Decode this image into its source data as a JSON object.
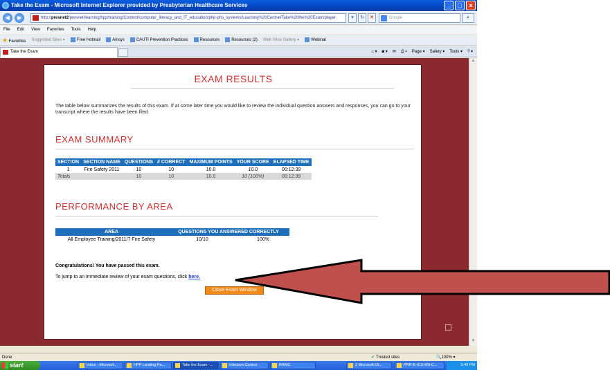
{
  "window": {
    "title": "Take the Exam - Microsoft Internet Explorer provided by Presbyterian Healthcare Services"
  },
  "address_bar": {
    "url_prefix": "http://",
    "url_host": "presnet2",
    "url_rest": "/presnet/learning/hpp/training/Content/computer_literacy_and_IT_education/php-phs_systems/Learning%20Central/Take%20the%20Exam/player.",
    "search_placeholder": "Google"
  },
  "menu": [
    "File",
    "Edit",
    "View",
    "Favorites",
    "Tools",
    "Help"
  ],
  "favorites_bar": {
    "label": "Favorites",
    "items": [
      "Suggested Sites ▾",
      "Free Hotmail",
      "Ainsys",
      "CAUTI Prevention Practices",
      "Resources",
      "Resources (2)",
      "Web Slice Gallery ▾",
      "Webinal"
    ]
  },
  "tab": {
    "label": "Take the Exam"
  },
  "command_bar": [
    "Page ▾",
    "Safety ▾",
    "Tools ▾"
  ],
  "page": {
    "title": "EXAM RESULTS",
    "intro": "The table below summarizes the results of this exam. If at some later time you would like to review the individual question answers and responses, you can go to your transcript where the results have been filed.",
    "summary_heading": "EXAM SUMMARY",
    "summary_table": {
      "headers": [
        "SECTION",
        "SECTION NAME",
        "QUESTIONS",
        "# CORRECT",
        "MAXIMUM POINTS",
        "YOUR SCORE",
        "ELAPSED TIME"
      ],
      "row": [
        "1",
        "Fire Safety 2011",
        "10",
        "10",
        "10.0",
        "10.0",
        "00:12:39"
      ],
      "totals": [
        "Totals",
        "",
        "10",
        "10",
        "10.0",
        "10 (100%)",
        "00:12:39"
      ]
    },
    "performance_heading": "PERFORMANCE BY AREA",
    "area_table": {
      "headers": [
        "AREA",
        "QUESTIONS YOU ANSWERED CORRECTLY"
      ],
      "row": [
        "All Employee Training/2011/7 Fire Safety",
        "10/10",
        "100%"
      ]
    },
    "congrats": "Congratulations! You have passed this exam.",
    "review_text": "To jump to an immediate review of your exam questions, click ",
    "review_link": "here.",
    "close_button": "Close Exam Window"
  },
  "status_bar": {
    "left": "Done",
    "zone": "Trusted sites",
    "zoom": "100%"
  },
  "taskbar": {
    "start": "start",
    "tasks": [
      "Inbox - Microsof...",
      "HPP Landing Pa...",
      "Take the Exam -...",
      "Infection Control",
      "RRMC",
      "2 Microsoft Of...",
      "PRR-E-ICU-RN-C..."
    ],
    "clock": "5:49 PM"
  },
  "colors": {
    "page_background": "#8b2a2e",
    "heading_red": "#cf2f2f",
    "table_header_blue": "#1e6fbc",
    "close_button_orange": "#f08a1a",
    "arrow_fill": "#c0504d"
  }
}
